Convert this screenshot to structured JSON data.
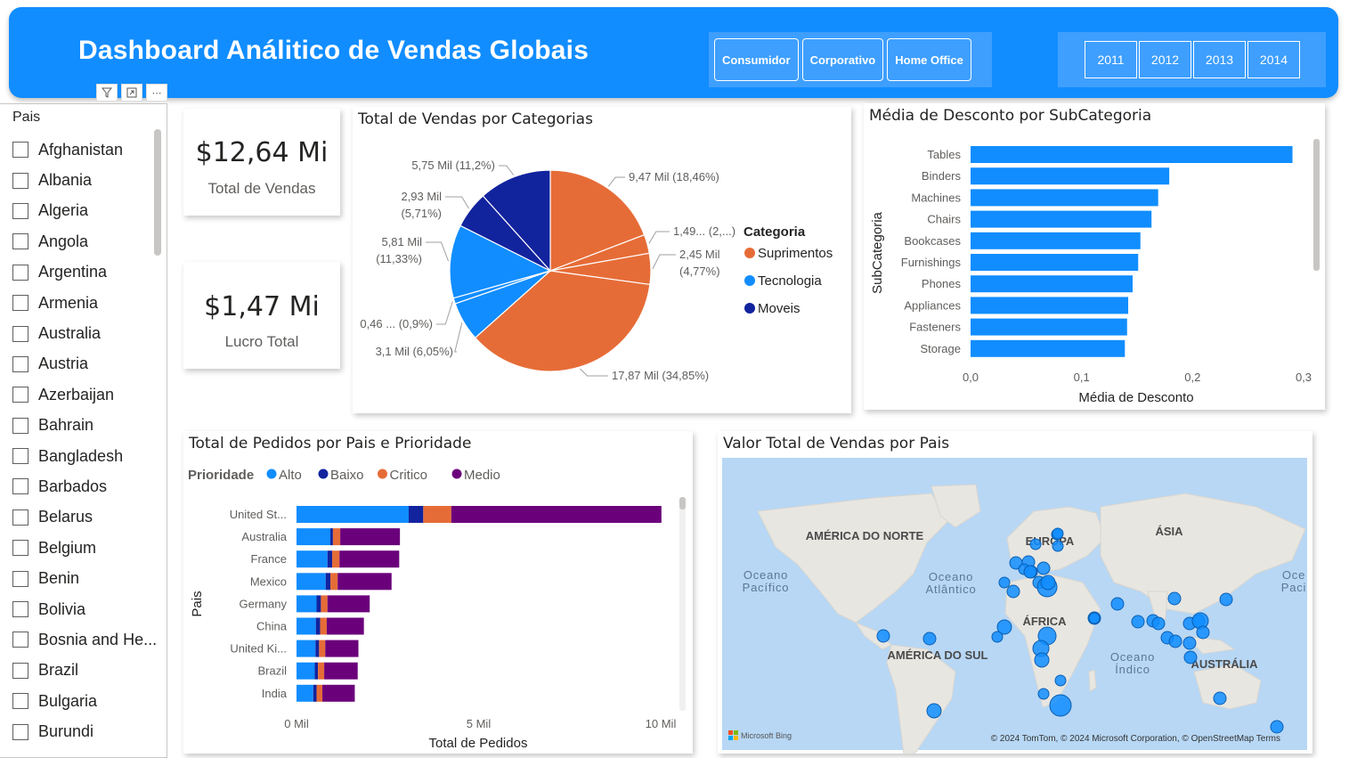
{
  "header": {
    "title": "Dashboard Análitico de Vendas Globais",
    "segments": [
      "Consumidor",
      "Corporativo",
      "Home Office"
    ],
    "years": [
      "2011",
      "2012",
      "2013",
      "2014"
    ]
  },
  "slicer": {
    "title": "Pais",
    "items": [
      "Afghanistan",
      "Albania",
      "Algeria",
      "Angola",
      "Argentina",
      "Armenia",
      "Australia",
      "Austria",
      "Azerbaijan",
      "Bahrain",
      "Bangladesh",
      "Barbados",
      "Belarus",
      "Belgium",
      "Benin",
      "Bolivia",
      "Bosnia and He...",
      "Brazil",
      "Bulgaria",
      "Burundi"
    ]
  },
  "kpis": {
    "sales_value": "$12,64 Mi",
    "sales_label": "Total de Vendas",
    "profit_value": "$1,47 Mi",
    "profit_label": "Lucro Total"
  },
  "colors": {
    "header": "#118DFF",
    "suprimentos": "#E66C37",
    "tecnologia": "#118DFF",
    "moveis": "#12239E",
    "medio": "#6B007B",
    "alto": "#118DFF",
    "baixo": "#12239E",
    "critico": "#E66C37"
  },
  "chart_data": [
    {
      "type": "pie",
      "title": "Total de Vendas por Categorias",
      "legend_title": "Categoria",
      "legend": [
        "Suprimentos",
        "Tecnologia",
        "Moveis"
      ],
      "slices": [
        {
          "category": "Suprimentos",
          "value": 9.47,
          "label": "9,47 Mil (18,46%)"
        },
        {
          "category": "Suprimentos",
          "value": 1.49,
          "label": "1,49... (2,...)"
        },
        {
          "category": "Suprimentos",
          "value": 2.45,
          "label": "2,45 Mil (4,77%)"
        },
        {
          "category": "Suprimentos",
          "value": 17.87,
          "label": "17,87 Mil (34,85%)"
        },
        {
          "category": "Tecnologia",
          "value": 3.1,
          "label": "3,1 Mil (6,05%)"
        },
        {
          "category": "Tecnologia",
          "value": 0.46,
          "label": "0,46 ... (0,9%)"
        },
        {
          "category": "Tecnologia",
          "value": 5.81,
          "label": "5,81 Mil (11,33%)"
        },
        {
          "category": "Moveis",
          "value": 2.93,
          "label": "2,93 Mil (5,71%)"
        },
        {
          "category": "Moveis",
          "value": 5.75,
          "label": "5,75 Mil (11,2%)"
        }
      ]
    },
    {
      "type": "bar",
      "orientation": "horizontal",
      "title": "Média de Desconto por SubCategoria",
      "xlabel": "Média de Desconto",
      "ylabel": "SubCategoria",
      "categories": [
        "Tables",
        "Binders",
        "Machines",
        "Chairs",
        "Bookcases",
        "Furnishings",
        "Phones",
        "Appliances",
        "Fasteners",
        "Storage"
      ],
      "values": [
        0.29,
        0.179,
        0.169,
        0.163,
        0.153,
        0.151,
        0.146,
        0.142,
        0.141,
        0.139
      ],
      "ticks": [
        "0,0",
        "0,1",
        "0,2",
        "0,3"
      ],
      "xlim": [
        0,
        0.3
      ]
    },
    {
      "type": "bar",
      "orientation": "horizontal",
      "stacked": true,
      "title": "Total de Pedidos por Pais e Prioridade",
      "legend_title": "Prioridade",
      "xlabel": "Total de Pedidos",
      "ylabel": "Pais",
      "categories": [
        "United St...",
        "Australia",
        "France",
        "Mexico",
        "Germany",
        "China",
        "United Ki...",
        "Brazil",
        "India"
      ],
      "series": [
        {
          "name": "Alto",
          "values": [
            3080,
            930,
            850,
            800,
            550,
            530,
            520,
            500,
            460
          ]
        },
        {
          "name": "Baixo",
          "values": [
            400,
            70,
            130,
            130,
            120,
            120,
            100,
            90,
            90
          ]
        },
        {
          "name": "Critico",
          "values": [
            770,
            200,
            200,
            200,
            180,
            180,
            170,
            170,
            160
          ]
        },
        {
          "name": "Medio",
          "values": [
            5770,
            1640,
            1640,
            1480,
            1160,
            1020,
            910,
            920,
            890
          ]
        }
      ],
      "ticks": [
        "0 Mil",
        "5 Mil",
        "10 Mil"
      ],
      "xlim": [
        0,
        10000
      ]
    },
    {
      "type": "map",
      "title": "Valor Total de Vendas por Pais",
      "continents": [
        "AMÉRICA DO NORTE",
        "EUROPA",
        "ÁSIA",
        "ÁFRICA",
        "AMÉRICA DO SUL",
        "AUSTRÁLIA"
      ],
      "oceans": [
        "Oceano Pacífico",
        "Oceano Atlântico",
        "Oceano Índico",
        "Oce Paci"
      ],
      "attribution": "© 2024 TomTom, © 2024 Microsoft Corporation, © OpenStreetMap  Terms",
      "brand": "Microsoft Bing"
    }
  ]
}
